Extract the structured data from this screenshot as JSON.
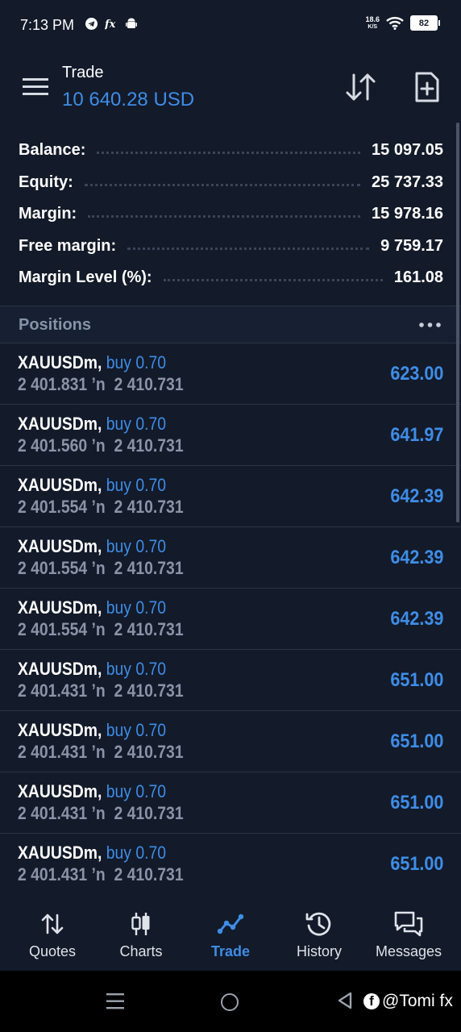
{
  "status": {
    "time": "7:13 PM",
    "net_speed_value": "18.6",
    "net_speed_unit": "K/S",
    "battery": "82"
  },
  "header": {
    "title": "Trade",
    "balance": "10 640.28 USD"
  },
  "account": [
    {
      "label": "Balance:",
      "value": "15 097.05"
    },
    {
      "label": "Equity:",
      "value": "25 737.33"
    },
    {
      "label": "Margin:",
      "value": "15 978.16"
    },
    {
      "label": "Free margin:",
      "value": "9 759.17"
    },
    {
      "label": "Margin Level (%):",
      "value": "161.08"
    }
  ],
  "positions_title": "Positions",
  "positions": [
    {
      "symbol": "XAUUSDm,",
      "side": "buy 0.70",
      "prices": "2 401.831 ’n  2 410.731",
      "profit": "623.00"
    },
    {
      "symbol": "XAUUSDm,",
      "side": "buy 0.70",
      "prices": "2 401.560 ’n  2 410.731",
      "profit": "641.97"
    },
    {
      "symbol": "XAUUSDm,",
      "side": "buy 0.70",
      "prices": "2 401.554 ’n  2 410.731",
      "profit": "642.39"
    },
    {
      "symbol": "XAUUSDm,",
      "side": "buy 0.70",
      "prices": "2 401.554 ’n  2 410.731",
      "profit": "642.39"
    },
    {
      "symbol": "XAUUSDm,",
      "side": "buy 0.70",
      "prices": "2 401.554 ’n  2 410.731",
      "profit": "642.39"
    },
    {
      "symbol": "XAUUSDm,",
      "side": "buy 0.70",
      "prices": "2 401.431 ’n  2 410.731",
      "profit": "651.00"
    },
    {
      "symbol": "XAUUSDm,",
      "side": "buy 0.70",
      "prices": "2 401.431 ’n  2 410.731",
      "profit": "651.00"
    },
    {
      "symbol": "XAUUSDm,",
      "side": "buy 0.70",
      "prices": "2 401.431 ’n  2 410.731",
      "profit": "651.00"
    },
    {
      "symbol": "XAUUSDm,",
      "side": "buy 0.70",
      "prices": "2 401.431 ’n  2 410.731",
      "profit": "651.00"
    }
  ],
  "tabs": [
    {
      "label": "Quotes",
      "icon": "quotes-icon"
    },
    {
      "label": "Charts",
      "icon": "charts-icon"
    },
    {
      "label": "Trade",
      "icon": "trade-icon",
      "active": true
    },
    {
      "label": "History",
      "icon": "history-icon"
    },
    {
      "label": "Messages",
      "icon": "messages-icon"
    }
  ],
  "watermark": "@Tomi fx",
  "colors": {
    "accent": "#3e8de7",
    "background": "#131a29",
    "muted": "#8a94a6"
  }
}
